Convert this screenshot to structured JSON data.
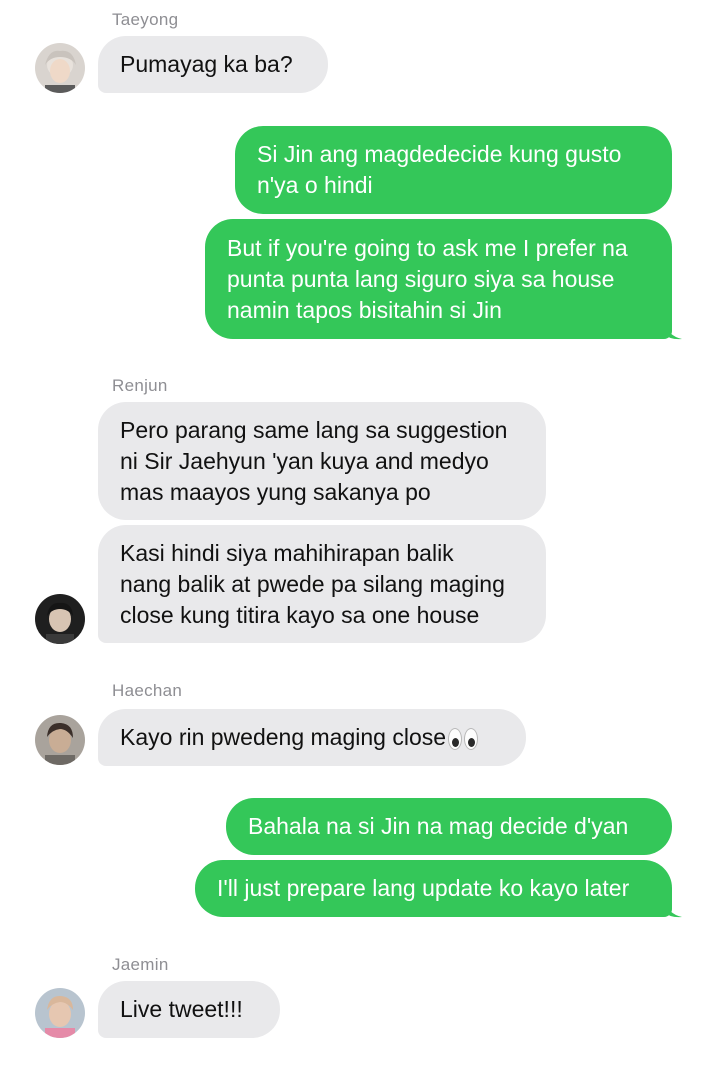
{
  "messages": {
    "taeyong": {
      "name": "Taeyong",
      "text": "Pumayag ka ba?"
    },
    "me1": {
      "line1": "Si Jin ang magdedecide kung gusto",
      "line2": "n'ya o hindi"
    },
    "me2": {
      "line1": "But if you're going to ask me I prefer na",
      "line2": "punta punta lang siguro siya sa house",
      "line3": "namin tapos bisitahin si Jin"
    },
    "renjun": {
      "name": "Renjun",
      "msg1": {
        "line1": "Pero parang same lang sa suggestion",
        "line2": "ni Sir Jaehyun 'yan kuya and medyo",
        "line3": "mas maayos yung sakanya po"
      },
      "msg2": {
        "line1": "Kasi hindi siya mahihirapan balik",
        "line2": "nang balik at pwede pa silang maging",
        "line3": "close kung titira kayo sa one house"
      }
    },
    "haechan": {
      "name": "Haechan",
      "text": "Kayo rin pwedeng maging close",
      "emoji": "eyes"
    },
    "me3": {
      "text": "Bahala na si Jin na mag decide d'yan"
    },
    "me4": {
      "text": "I'll just prepare lang update ko kayo later"
    },
    "jaemin": {
      "name": "Jaemin",
      "text": "Live tweet!!!"
    }
  },
  "colors": {
    "incoming_bubble": "#e9e9eb",
    "outgoing_bubble": "#34c759",
    "sender_name": "#8e8e93"
  }
}
